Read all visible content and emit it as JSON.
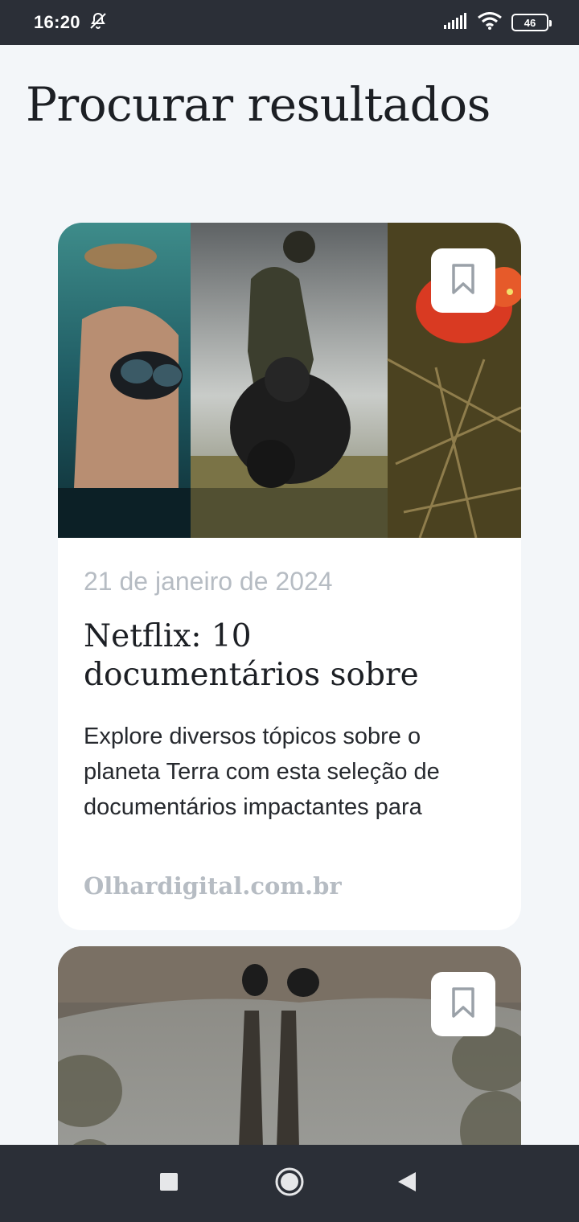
{
  "status_bar": {
    "time": "16:20",
    "battery": "46",
    "icons": [
      "bell-off-icon",
      "signal-icon",
      "wifi-icon",
      "battery-icon"
    ]
  },
  "page": {
    "title": "Procurar resultados"
  },
  "results": [
    {
      "date": "21 de janeiro de 2024",
      "title": "Netflix: 10 documentários sobre",
      "description": "Explore diversos tópicos sobre o planeta Terra com esta seleção de documentários impactantes para",
      "source": "Olhardigital.com.br",
      "bookmark_icon": "bookmark-icon"
    },
    {
      "bookmark_icon": "bookmark-icon"
    }
  ],
  "nav_bar": {
    "icons": [
      "recents-square-icon",
      "home-circle-icon",
      "back-triangle-icon"
    ]
  },
  "colors": {
    "background": "#f3f6f9",
    "system_bar": "#2b2f37",
    "muted_text": "#b6bcc3",
    "title_text": "#1c1f24"
  }
}
